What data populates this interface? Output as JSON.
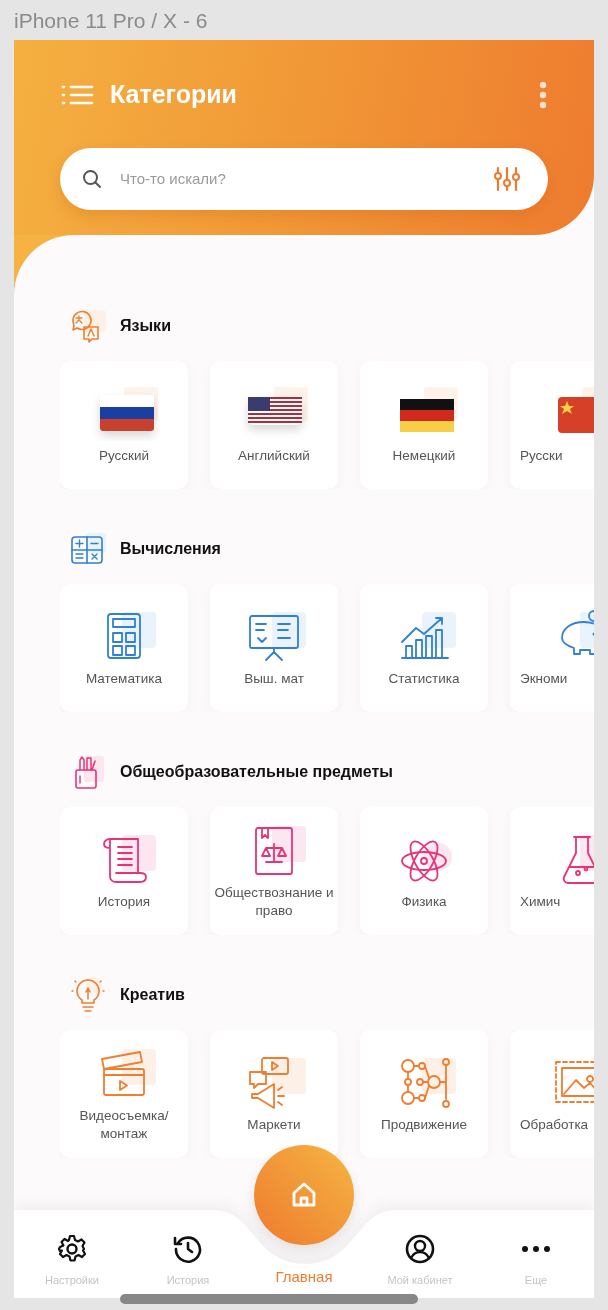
{
  "artboard_label": "iPhone 11 Pro / X - 6",
  "header": {
    "title": "Категории"
  },
  "search": {
    "placeholder": "Что-то искали?"
  },
  "sections": [
    {
      "title": "Языки",
      "kind": "languages",
      "items": [
        {
          "label": "Русский",
          "kind": "ru"
        },
        {
          "label": "Английский",
          "kind": "us"
        },
        {
          "label": "Немецкий",
          "kind": "de"
        },
        {
          "label": "Русски",
          "kind": "cn"
        }
      ]
    },
    {
      "title": "Вычисления",
      "kind": "calculations",
      "items": [
        {
          "label": "Математика",
          "kind": "calculator"
        },
        {
          "label": "Выш. мат",
          "kind": "lecture"
        },
        {
          "label": "Статистика",
          "kind": "chart"
        },
        {
          "label": "Экноми",
          "kind": "piggybank"
        }
      ]
    },
    {
      "title": "Общеобразовательные предметы",
      "kind": "school",
      "items": [
        {
          "label": "История",
          "kind": "scroll"
        },
        {
          "label": "Обществознание и право",
          "kind": "law"
        },
        {
          "label": "Физика",
          "kind": "atom"
        },
        {
          "label": "Химич",
          "kind": "flask"
        }
      ]
    },
    {
      "title": "Креатив",
      "kind": "creative",
      "items": [
        {
          "label": "Видеосъемка/ монтаж",
          "kind": "clapper"
        },
        {
          "label": "Маркети",
          "kind": "megaphone"
        },
        {
          "label": "Продвижение",
          "kind": "network"
        },
        {
          "label": "Обработка",
          "kind": "image"
        }
      ]
    }
  ],
  "tab_bar": [
    {
      "label": "Настройки",
      "kind": "gear",
      "selected": false
    },
    {
      "label": "История",
      "kind": "history",
      "selected": false
    },
    {
      "label": "Главная",
      "kind": "home",
      "selected": true
    },
    {
      "label": "Мой кабинет",
      "kind": "profile",
      "selected": false
    },
    {
      "label": "Еще",
      "kind": "more",
      "selected": false
    }
  ]
}
